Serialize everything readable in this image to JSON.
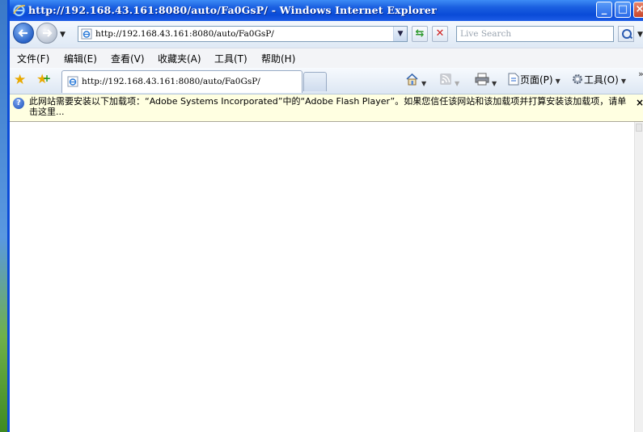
{
  "window": {
    "title": "http://192.168.43.161:8080/auto/Fa0GsP/ - Windows Internet Explorer",
    "min_label": "_",
    "max_label": "□",
    "close_label": "×"
  },
  "address_bar": {
    "url": "http://192.168.43.161:8080/auto/Fa0GsP/"
  },
  "search": {
    "placeholder": "Live Search"
  },
  "menu": {
    "items": [
      "文件(F)",
      "编辑(E)",
      "查看(V)",
      "收藏夹(A)",
      "工具(T)",
      "帮助(H)"
    ]
  },
  "tab": {
    "label": "http://192.168.43.161:8080/auto/Fa0GsP/"
  },
  "command_bar": {
    "page_label": "页面(P)",
    "tools_label": "工具(O)"
  },
  "info_bar": {
    "message": "此网站需要安装以下加载项：“Adobe Systems Incorporated”中的“Adobe Flash Player”。如果您信任该网站和该加载项并打算安装该加载项，请单击这里...",
    "close_label": "×"
  },
  "icons": {
    "back": "back-arrow-icon",
    "forward": "forward-arrow-icon",
    "refresh": "refresh-icon",
    "stop": "stop-icon",
    "search": "search-icon",
    "favorites": "favorites-star-icon",
    "add_favorites": "add-favorites-icon",
    "home": "home-icon",
    "feeds": "feeds-icon",
    "print": "print-icon",
    "page": "page-icon",
    "tools": "gear-icon",
    "info": "info-icon"
  },
  "colors": {
    "titlebar": "#0a4bd8",
    "infobar": "#ffffe1",
    "stop": "#d02020",
    "refresh": "#2f9a2f"
  }
}
